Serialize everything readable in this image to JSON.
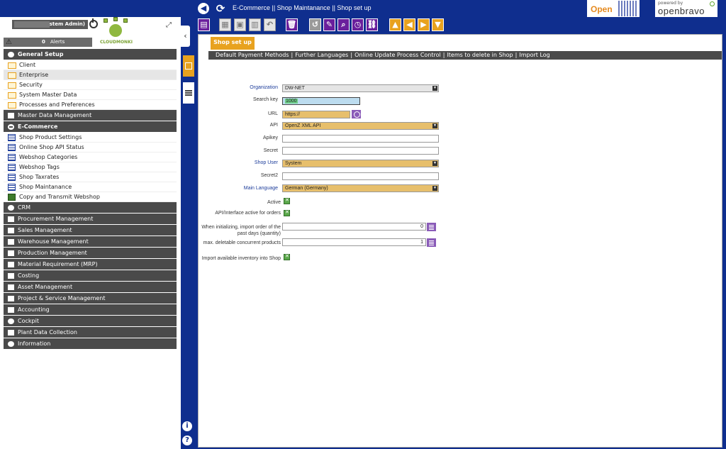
{
  "topbar": {
    "back_icon": "arrow-left-icon",
    "refresh_icon": "refresh-icon",
    "breadcrumb": "E-Commerce || Shop Maintanance  ||  Shop set up",
    "logo_openz": "Open",
    "logo_powered": "powered by",
    "logo_openbravo": "openbravo"
  },
  "leftpanel": {
    "user_role": "(System Admin)",
    "logo_text": "CLOUDMONKI",
    "alerts_count": "0",
    "alerts_label": "Alerts"
  },
  "menu": {
    "general_setup": "General Setup",
    "client": "Client",
    "enterprise": "Enterprise",
    "security": "Security",
    "system_master_data": "System Master Data",
    "processes_prefs": "Processes and Preferences",
    "master_data": "Master Data Management",
    "ecommerce": "E-Commerce",
    "shop_product_settings": "Shop Product Settings",
    "online_shop_api_status": "Online Shop API Status",
    "webshop_categories": "Webshop Categories",
    "webshop_tags": "Webshop Tags",
    "shop_taxrates": "Shop Taxrates",
    "shop_maintanance": "Shop Maintanance",
    "copy_transmit": "Copy and Transmit Webshop",
    "crm": "CRM",
    "procurement": "Procurement Management",
    "sales": "Sales Management",
    "warehouse": "Warehouse Management",
    "production": "Production Management",
    "mrp": "Material Requirement (MRP)",
    "costing": "Costing",
    "asset": "Asset Management",
    "project": "Project & Service Management",
    "accounting": "Accounting",
    "cockpit": "Cockpit",
    "plant_data": "Plant Data Collection",
    "information": "Information"
  },
  "window": {
    "tab_label": "Shop set up",
    "sublinks": [
      "Default Payment Methods",
      "Further Languages",
      "Online Update Process Control",
      "Items to delete in Shop",
      "Import Log"
    ]
  },
  "form": {
    "organization_label": "Organization",
    "organization_value": "DW-NET",
    "search_key_label": "Search key",
    "search_key_value": "1000",
    "url_label": "URL",
    "url_value": "https://",
    "api_label": "API",
    "api_value": "OpenZ XML API",
    "apikey_label": "Apikey",
    "apikey_value": "",
    "secret_label": "Secret",
    "secret_value": "",
    "shop_user_label": "Shop User",
    "shop_user_value": "System",
    "secret2_label": "Secret2",
    "secret2_value": "",
    "main_language_label": "Main Language",
    "main_language_value": "German (Germany)",
    "active_label": "Active",
    "api_active_label": "API/Interface active for orders",
    "import_days_label": "When initializing, import order of the past days (quantity)",
    "import_days_value": "0",
    "max_delete_label": "max. deletable concurrent products",
    "max_delete_value": "1",
    "import_inventory_label": "Import available inventory into Shop"
  },
  "colors": {
    "navy": "#0f2e8e",
    "orange": "#e8a21f",
    "purple": "#6a1f9c",
    "dark_header": "#4a4a4a"
  }
}
